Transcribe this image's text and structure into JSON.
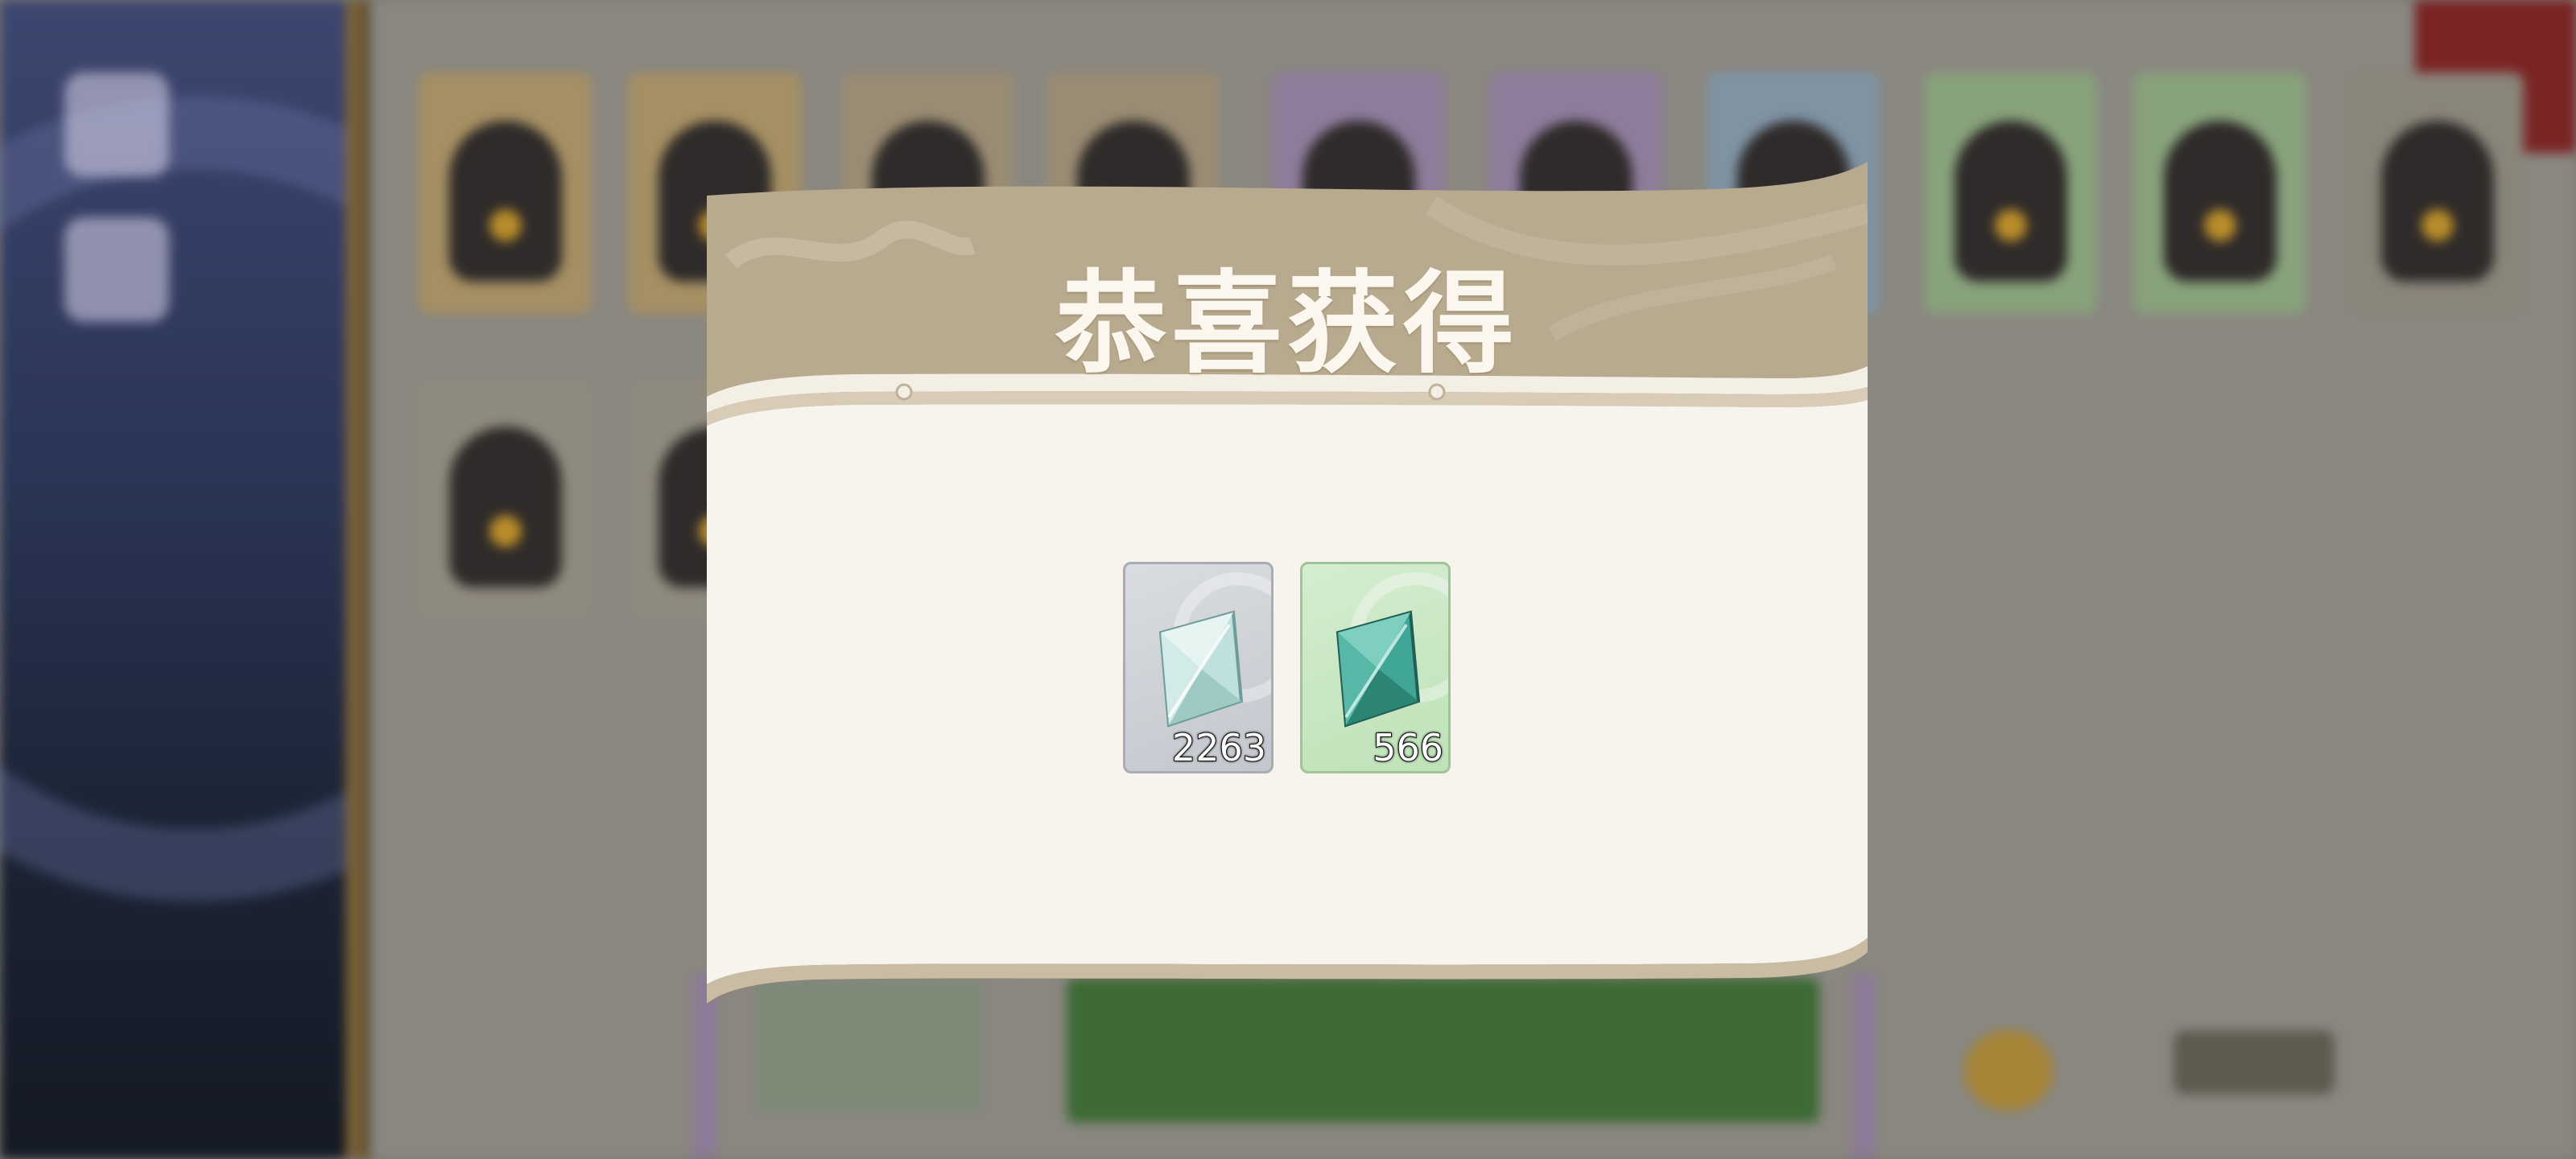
{
  "dialog": {
    "title": "恭喜获得"
  },
  "rewards": [
    {
      "icon": "grey-crystal-icon",
      "count": "2263",
      "color": "#c9ccd1"
    },
    {
      "icon": "green-crystal-icon",
      "count": "566",
      "color": "#c6e6bf"
    }
  ],
  "colors": {
    "header": "#b8aa8f",
    "panel": "#f7f4ee",
    "title_text": "#fbf7ee"
  }
}
